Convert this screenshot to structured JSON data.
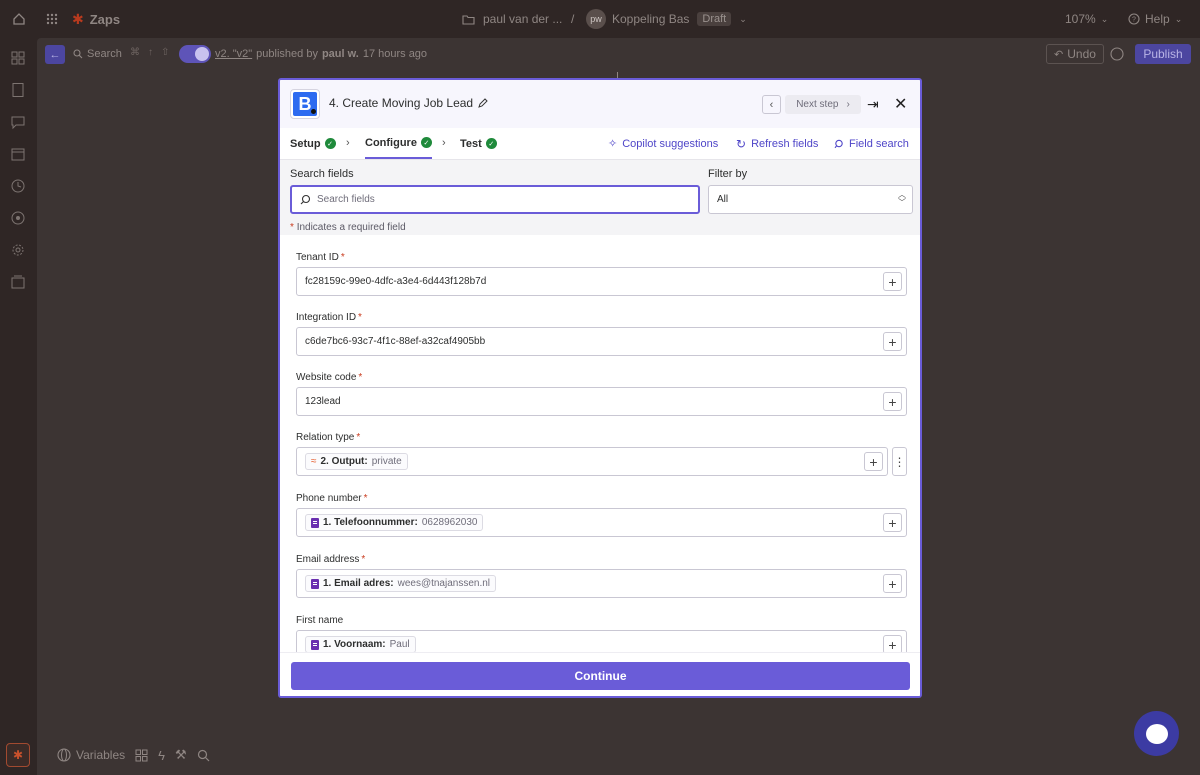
{
  "topbar": {
    "app_name": "Zaps",
    "folder": "paul van der ...",
    "separator": "/",
    "avatar_initials": "pw",
    "zap_name": "Koppeling Bas",
    "status_badge": "Draft",
    "zoom": "107%",
    "help_label": "Help"
  },
  "canvas_bar": {
    "search_label": "Search",
    "version_text": "v2. \"v2\"",
    "published_by": "published by",
    "publisher": "paul w.",
    "published_time": "17 hours ago",
    "undo_label": "Undo",
    "publish_label": "Publish"
  },
  "bottom_tools": {
    "variables_label": "Variables"
  },
  "modal": {
    "step_title": "4. Create Moving Job Lead",
    "next_step_label": "Next step",
    "tabs": [
      {
        "label": "Setup"
      },
      {
        "label": "Configure"
      },
      {
        "label": "Test"
      }
    ],
    "links": {
      "copilot": "Copilot suggestions",
      "refresh": "Refresh fields",
      "field_search": "Field search"
    },
    "search_fields_label": "Search fields",
    "search_placeholder": "Search fields",
    "filter_label": "Filter by",
    "filter_value": "All",
    "required_note": "Indicates a required field",
    "fields": [
      {
        "label": "Tenant ID",
        "required": "*",
        "value": "fc28159c-99e0-4dfc-a3e4-6d443f128b7d"
      },
      {
        "label": "Integration ID",
        "required": "*",
        "value": "c6de7bc6-93c7-4f1c-88ef-a32caf4905bb"
      },
      {
        "label": "Website code",
        "required": "*",
        "value": "123lead"
      },
      {
        "label": "Relation type",
        "required": "*",
        "pill_key": "2. Output:",
        "pill_value": "private"
      },
      {
        "label": "Phone number",
        "required": "*",
        "pill_key": "1. Telefoonnummer:",
        "pill_value": "0628962030"
      },
      {
        "label": "Email address",
        "required": "*",
        "pill_key": "1. Email adres:",
        "pill_value": "wees@tnajanssen.nl"
      },
      {
        "label": "First name",
        "pill_key": "1. Voornaam:",
        "pill_value": "Paul"
      }
    ],
    "continue_label": "Continue"
  },
  "colors": {
    "accent": "#6a5cd8",
    "success": "#1f8a3b",
    "required": "#c93b1e",
    "app_brand": "#2d6bf0"
  },
  "icons": [
    "home-icon",
    "grid-icon",
    "zap-icon",
    "folder-icon",
    "pencil-icon",
    "chevron-left-icon",
    "chevron-right-icon",
    "jump-icon",
    "close-icon",
    "check-icon",
    "sparkle-icon",
    "refresh-icon",
    "search-icon",
    "plus-icon",
    "kebab-icon",
    "form-icon",
    "formatter-icon",
    "chat-icon",
    "help-icon"
  ]
}
